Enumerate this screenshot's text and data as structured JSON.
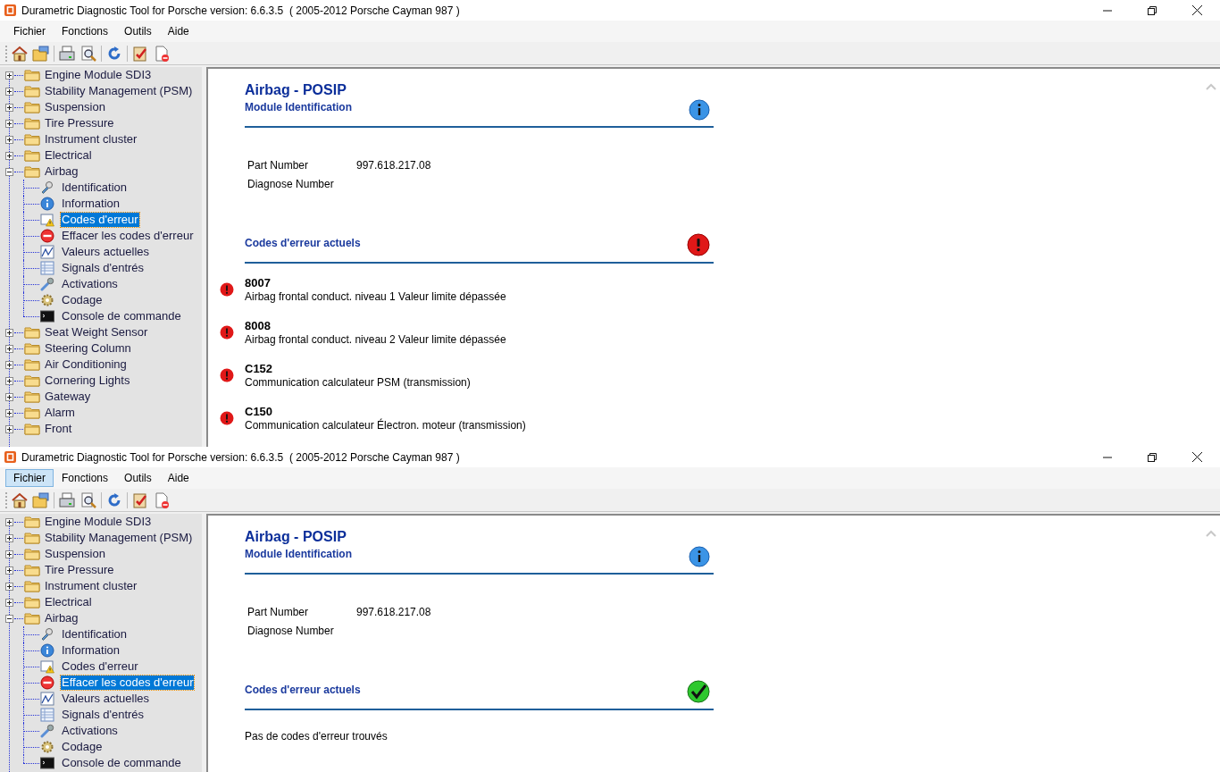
{
  "windows": [
    {
      "title": "Durametric Diagnostic Tool for Porsche version: 6.6.3.5  ( 2005-2012 Porsche Cayman 987 )",
      "menu": [
        {
          "label": "Fichier",
          "selected": false
        },
        {
          "label": "Fonctions",
          "selected": false
        },
        {
          "label": "Outils",
          "selected": false
        },
        {
          "label": "Aide",
          "selected": false
        }
      ],
      "tree": [
        {
          "label": "Engine Module SDI3",
          "expanded": false,
          "selected": false
        },
        {
          "label": "Stability Management (PSM)",
          "expanded": false,
          "selected": false
        },
        {
          "label": "Suspension",
          "expanded": false,
          "selected": false
        },
        {
          "label": "Tire Pressure",
          "expanded": false,
          "selected": false
        },
        {
          "label": "Instrument cluster",
          "expanded": false,
          "selected": false
        },
        {
          "label": "Electrical",
          "expanded": false,
          "selected": false
        },
        {
          "label": "Airbag",
          "expanded": true,
          "selected": false,
          "children": [
            {
              "kind": "identification",
              "label": "Identification",
              "selected": false
            },
            {
              "kind": "information",
              "label": "Information",
              "selected": false
            },
            {
              "kind": "fault-codes",
              "label": "Codes d'erreur",
              "selected": true
            },
            {
              "kind": "clear-codes",
              "label": "Effacer les codes d'erreur",
              "selected": false
            },
            {
              "kind": "values",
              "label": "Valeurs actuelles",
              "selected": false
            },
            {
              "kind": "signals",
              "label": "Signals d'entrés",
              "selected": false
            },
            {
              "kind": "activations",
              "label": "Activations",
              "selected": false
            },
            {
              "kind": "coding",
              "label": "Codage",
              "selected": false
            },
            {
              "kind": "console",
              "label": "Console de commande",
              "selected": false
            }
          ]
        },
        {
          "label": "Seat Weight Sensor",
          "expanded": false,
          "selected": false
        },
        {
          "label": "Steering Column",
          "expanded": false,
          "selected": false
        },
        {
          "label": "Air Conditioning",
          "expanded": false,
          "selected": false
        },
        {
          "label": "Cornering Lights",
          "expanded": false,
          "selected": false
        },
        {
          "label": "Gateway",
          "expanded": false,
          "selected": false
        },
        {
          "label": "Alarm",
          "expanded": false,
          "selected": false
        },
        {
          "label": "Front",
          "expanded": false,
          "selected": false
        }
      ],
      "content": {
        "module_title": "Airbag - POSIP",
        "identification": {
          "heading": "Module Identification",
          "fields": [
            {
              "label": "Part Number",
              "value": "997.618.217.08"
            },
            {
              "label": "Diagnose Number"
            }
          ]
        },
        "fault_section": {
          "heading": "Codes d'erreur actuels",
          "kind": "error",
          "codes": [
            {
              "code": "8007",
              "description": "Airbag frontal conduct. niveau 1 Valeur limite dépassée"
            },
            {
              "code": "8008",
              "description": "Airbag frontal conduct. niveau 2 Valeur limite dépassée"
            },
            {
              "code": "C152",
              "description": "Communication calculateur PSM (transmission)"
            },
            {
              "code": "C150",
              "description": "Communication calculateur Électron. moteur (transmission)"
            }
          ]
        }
      }
    },
    {
      "title": "Durametric Diagnostic Tool for Porsche version: 6.6.3.5  ( 2005-2012 Porsche Cayman 987 )",
      "menu": [
        {
          "label": "Fichier",
          "selected": true
        },
        {
          "label": "Fonctions",
          "selected": false
        },
        {
          "label": "Outils",
          "selected": false
        },
        {
          "label": "Aide",
          "selected": false
        }
      ],
      "tree": [
        {
          "label": "Engine Module SDI3",
          "expanded": false,
          "selected": false
        },
        {
          "label": "Stability Management (PSM)",
          "expanded": false,
          "selected": false
        },
        {
          "label": "Suspension",
          "expanded": false,
          "selected": false
        },
        {
          "label": "Tire Pressure",
          "expanded": false,
          "selected": false
        },
        {
          "label": "Instrument cluster",
          "expanded": false,
          "selected": false
        },
        {
          "label": "Electrical",
          "expanded": false,
          "selected": false
        },
        {
          "label": "Airbag",
          "expanded": true,
          "selected": false,
          "children": [
            {
              "kind": "identification",
              "label": "Identification",
              "selected": false
            },
            {
              "kind": "information",
              "label": "Information",
              "selected": false
            },
            {
              "kind": "fault-codes",
              "label": "Codes d'erreur",
              "selected": false
            },
            {
              "kind": "clear-codes",
              "label": "Effacer les codes d'erreur",
              "selected": true
            },
            {
              "kind": "values",
              "label": "Valeurs actuelles",
              "selected": false
            },
            {
              "kind": "signals",
              "label": "Signals d'entrés",
              "selected": false
            },
            {
              "kind": "activations",
              "label": "Activations",
              "selected": false
            },
            {
              "kind": "coding",
              "label": "Codage",
              "selected": false
            },
            {
              "kind": "console",
              "label": "Console de commande",
              "selected": false
            }
          ]
        }
      ],
      "content": {
        "module_title": "Airbag - POSIP",
        "identification": {
          "heading": "Module Identification",
          "fields": [
            {
              "label": "Part Number",
              "value": "997.618.217.08"
            },
            {
              "label": "Diagnose Number"
            }
          ]
        },
        "fault_section": {
          "heading": "Codes d'erreur actuels",
          "kind": "ok",
          "message": "Pas de codes d'erreur trouvés"
        }
      }
    }
  ]
}
